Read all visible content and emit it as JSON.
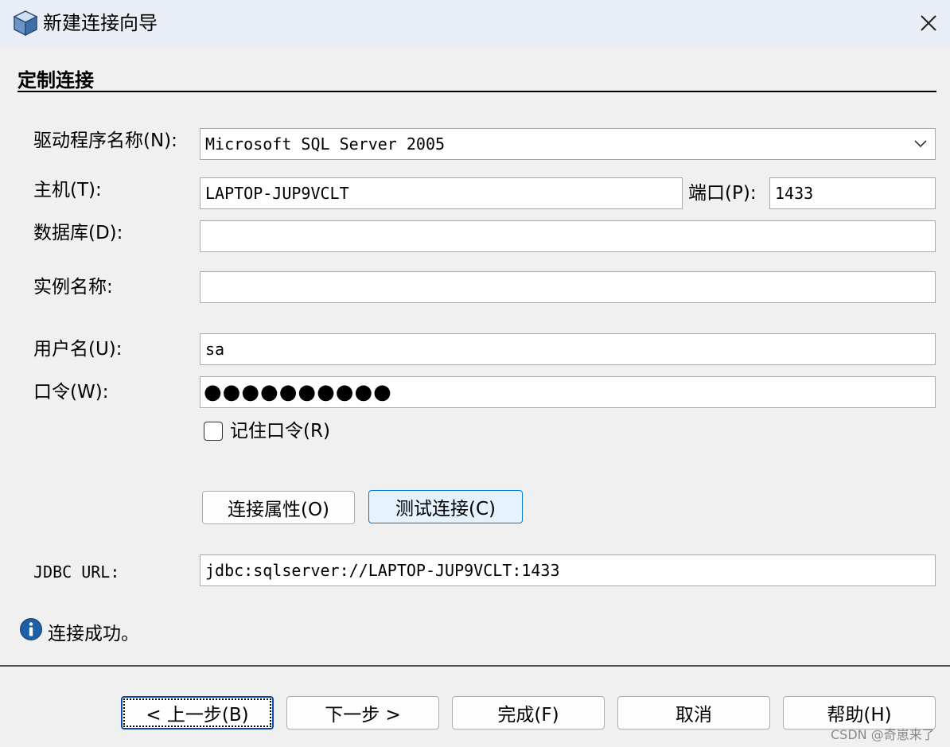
{
  "window": {
    "title": "新建连接向导",
    "close_glyph": "✕"
  },
  "section": {
    "title": "定制连接"
  },
  "form": {
    "driver_label": "驱动程序名称(N):",
    "driver_value": "Microsoft SQL Server 2005",
    "host_label": "主机(T):",
    "host_value": "LAPTOP-JUP9VCLT",
    "port_label": "端口(P):",
    "port_value": "1433",
    "database_label": "数据库(D):",
    "database_value": "",
    "instance_label": "实例名称:",
    "instance_value": "",
    "username_label": "用户名(U):",
    "username_value": "sa",
    "password_label": "口令(W):",
    "password_mask": "●●●●●●●●●●",
    "remember_label": "记住口令(R)",
    "remember_checked": false,
    "jdbc_label": "JDBC URL:",
    "jdbc_value": "jdbc:sqlserver://LAPTOP-JUP9VCLT:1433"
  },
  "actions": {
    "connection_properties": "连接属性(O)",
    "test_connection": "测试连接(C)"
  },
  "status": {
    "icon": "info-icon",
    "text": "连接成功。"
  },
  "footer": {
    "back": "< 上一步(B)",
    "next": "下一步 >",
    "finish": "完成(F)",
    "cancel": "取消",
    "help": "帮助(H)"
  },
  "watermark": "CSDN @奇崽来了",
  "colors": {
    "titlebar_bg": "#e9eef6",
    "window_bg": "#f0f0f0",
    "accent": "#0078d7",
    "info_blue": "#1f5fa8"
  }
}
